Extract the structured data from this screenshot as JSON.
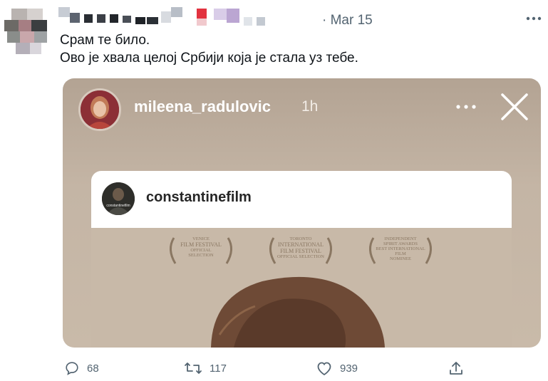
{
  "tweet": {
    "timestamp": "· Mar 15",
    "text_line1": "Срам те било.",
    "text_line2": "Ово је хвала целој Србији која је стала уз тебе."
  },
  "story": {
    "username": "mileena_radulovic",
    "time": "1h"
  },
  "shared_post": {
    "username": "constantinefilm",
    "avatar_caption": "constantinefilm"
  },
  "poster": {
    "laurels": [
      {
        "lines": [
          "VENICE",
          "FILM FESTIVAL",
          "OFFICIAL",
          "SELECTION"
        ]
      },
      {
        "lines": [
          "TORONTO",
          "INTERNATIONAL",
          "FILM FESTIVAL",
          "OFFICIAL SELECTION"
        ]
      },
      {
        "lines": [
          "INDEPENDENT",
          "SPIRIT AWARDS",
          "BEST INTERNATIONAL FILM",
          "NOMINEE"
        ]
      }
    ]
  },
  "actions": {
    "replies": "68",
    "retweets": "117",
    "likes": "939"
  },
  "colors": {
    "muted": "#536471",
    "text": "#0f1419",
    "media_bg": "#c4b5a5"
  }
}
